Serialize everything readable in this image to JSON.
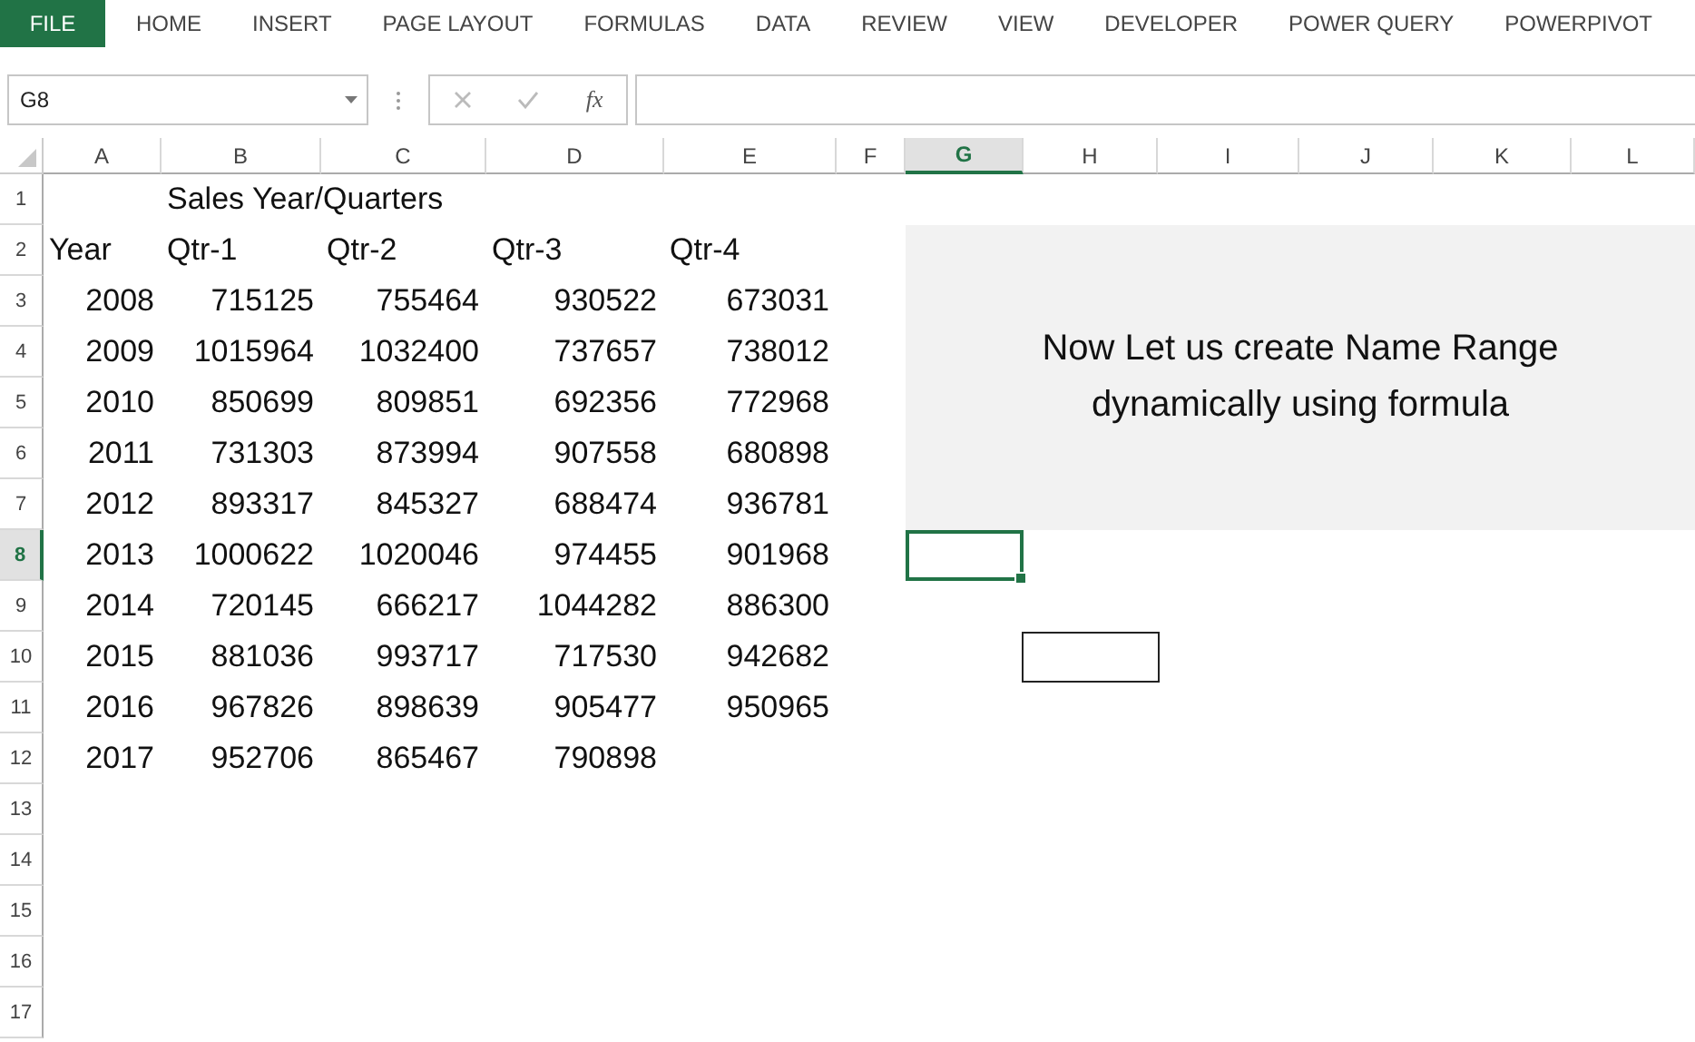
{
  "ribbon": {
    "file_tab": "FILE",
    "tabs": [
      {
        "label": "HOME",
        "selected": false
      },
      {
        "label": "INSERT",
        "selected": false
      },
      {
        "label": "PAGE LAYOUT",
        "selected": false
      },
      {
        "label": "FORMULAS",
        "selected": false
      },
      {
        "label": "DATA",
        "selected": false
      },
      {
        "label": "REVIEW",
        "selected": false
      },
      {
        "label": "VIEW",
        "selected": false
      },
      {
        "label": "DEVELOPER",
        "selected": false
      },
      {
        "label": "POWER QUERY",
        "selected": false
      },
      {
        "label": "POWERPIVOT",
        "selected": false
      }
    ]
  },
  "name_box": {
    "value": "G8"
  },
  "formula_bar": {
    "function_label": "fx"
  },
  "columns": [
    {
      "label": "A",
      "selected": false
    },
    {
      "label": "B",
      "selected": false
    },
    {
      "label": "C",
      "selected": false
    },
    {
      "label": "D",
      "selected": false
    },
    {
      "label": "E",
      "selected": false
    },
    {
      "label": "F",
      "selected": false
    },
    {
      "label": "G",
      "selected": true
    },
    {
      "label": "H",
      "selected": false
    },
    {
      "label": "I",
      "selected": false
    },
    {
      "label": "J",
      "selected": false
    },
    {
      "label": "K",
      "selected": false
    },
    {
      "label": "L",
      "selected": false
    }
  ],
  "rows": [
    {
      "label": "1",
      "selected": false,
      "cells": [
        null,
        {
          "kind": "text",
          "value": "Sales Year/Quarters"
        }
      ]
    },
    {
      "label": "2",
      "selected": false,
      "cells": [
        {
          "kind": "text",
          "value": "Year"
        },
        {
          "kind": "text",
          "value": "Qtr-1"
        },
        {
          "kind": "text",
          "value": "Qtr-2"
        },
        {
          "kind": "text",
          "value": "Qtr-3"
        },
        {
          "kind": "text",
          "value": "Qtr-4"
        }
      ]
    },
    {
      "label": "3",
      "selected": false,
      "cells": [
        {
          "kind": "number",
          "value": "2008"
        },
        {
          "kind": "number",
          "value": "715125"
        },
        {
          "kind": "number",
          "value": "755464"
        },
        {
          "kind": "number",
          "value": "930522"
        },
        {
          "kind": "number",
          "value": "673031"
        }
      ]
    },
    {
      "label": "4",
      "selected": false,
      "cells": [
        {
          "kind": "number",
          "value": "2009"
        },
        {
          "kind": "number",
          "value": "1015964"
        },
        {
          "kind": "number",
          "value": "1032400"
        },
        {
          "kind": "number",
          "value": "737657"
        },
        {
          "kind": "number",
          "value": "738012"
        }
      ]
    },
    {
      "label": "5",
      "selected": false,
      "cells": [
        {
          "kind": "number",
          "value": "2010"
        },
        {
          "kind": "number",
          "value": "850699"
        },
        {
          "kind": "number",
          "value": "809851"
        },
        {
          "kind": "number",
          "value": "692356"
        },
        {
          "kind": "number",
          "value": "772968"
        }
      ]
    },
    {
      "label": "6",
      "selected": false,
      "cells": [
        {
          "kind": "number",
          "value": "2011"
        },
        {
          "kind": "number",
          "value": "731303"
        },
        {
          "kind": "number",
          "value": "873994"
        },
        {
          "kind": "number",
          "value": "907558"
        },
        {
          "kind": "number",
          "value": "680898"
        }
      ]
    },
    {
      "label": "7",
      "selected": false,
      "cells": [
        {
          "kind": "number",
          "value": "2012"
        },
        {
          "kind": "number",
          "value": "893317"
        },
        {
          "kind": "number",
          "value": "845327"
        },
        {
          "kind": "number",
          "value": "688474"
        },
        {
          "kind": "number",
          "value": "936781"
        }
      ]
    },
    {
      "label": "8",
      "selected": true,
      "cells": [
        {
          "kind": "number",
          "value": "2013"
        },
        {
          "kind": "number",
          "value": "1000622"
        },
        {
          "kind": "number",
          "value": "1020046"
        },
        {
          "kind": "number",
          "value": "974455"
        },
        {
          "kind": "number",
          "value": "901968"
        }
      ]
    },
    {
      "label": "9",
      "selected": false,
      "cells": [
        {
          "kind": "number",
          "value": "2014"
        },
        {
          "kind": "number",
          "value": "720145"
        },
        {
          "kind": "number",
          "value": "666217"
        },
        {
          "kind": "number",
          "value": "1044282"
        },
        {
          "kind": "number",
          "value": "886300"
        }
      ]
    },
    {
      "label": "10",
      "selected": false,
      "cells": [
        {
          "kind": "number",
          "value": "2015"
        },
        {
          "kind": "number",
          "value": "881036"
        },
        {
          "kind": "number",
          "value": "993717"
        },
        {
          "kind": "number",
          "value": "717530"
        },
        {
          "kind": "number",
          "value": "942682"
        }
      ]
    },
    {
      "label": "11",
      "selected": false,
      "cells": [
        {
          "kind": "number",
          "value": "2016"
        },
        {
          "kind": "number",
          "value": "967826"
        },
        {
          "kind": "number",
          "value": "898639"
        },
        {
          "kind": "number",
          "value": "905477"
        },
        {
          "kind": "number",
          "value": "950965"
        }
      ]
    },
    {
      "label": "12",
      "selected": false,
      "cells": [
        {
          "kind": "number",
          "value": "2017"
        },
        {
          "kind": "number",
          "value": "952706"
        },
        {
          "kind": "number",
          "value": "865467"
        },
        {
          "kind": "number",
          "value": "790898"
        }
      ]
    },
    {
      "label": "13",
      "selected": false,
      "cells": []
    },
    {
      "label": "14",
      "selected": false,
      "cells": []
    },
    {
      "label": "15",
      "selected": false,
      "cells": []
    },
    {
      "label": "16",
      "selected": false,
      "cells": []
    },
    {
      "label": "17",
      "selected": false,
      "cells": []
    }
  ],
  "shapes": [
    {
      "kind": "text_box",
      "text": "Now Let us create Name Range dynamically using formula"
    },
    {
      "kind": "rectangle"
    }
  ]
}
